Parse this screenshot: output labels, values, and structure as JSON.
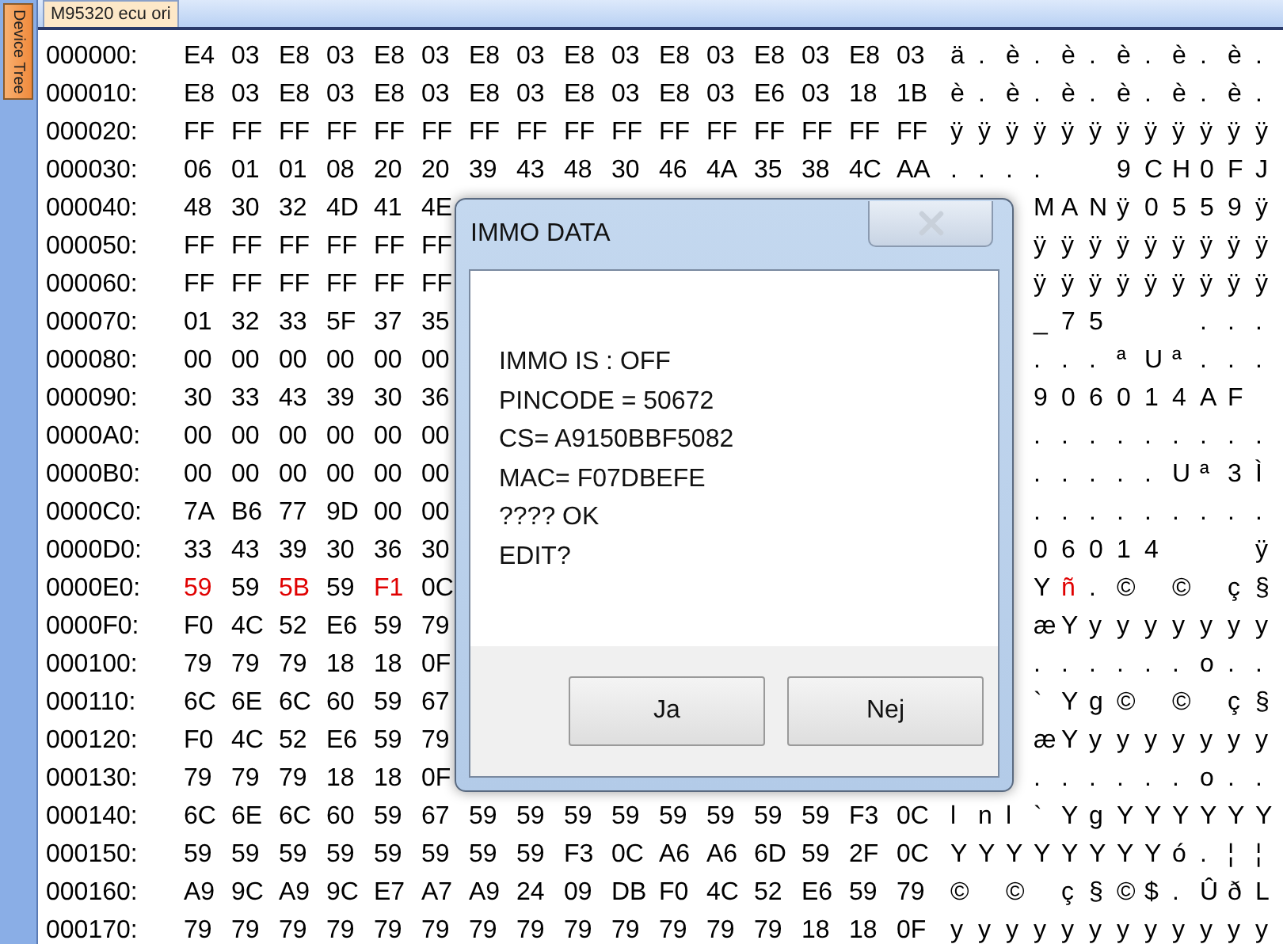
{
  "sidebar": {
    "tab": "Device Tree"
  },
  "tabs": [
    {
      "label": "M95320 ecu ori",
      "selected": true
    }
  ],
  "rows": [
    {
      "offset": "000000:",
      "hex": [
        "E4",
        "03",
        "E8",
        "03",
        "E8",
        "03",
        "E8",
        "03",
        "E8",
        "03",
        "E8",
        "03",
        "E8",
        "03",
        "E8",
        "03"
      ],
      "ascii": "ä . è . è . è . è . è ."
    },
    {
      "offset": "000010:",
      "hex": [
        "E8",
        "03",
        "E8",
        "03",
        "E8",
        "03",
        "E8",
        "03",
        "E8",
        "03",
        "E8",
        "03",
        "E6",
        "03",
        "18",
        "1B"
      ],
      "ascii": "è . è . è . è . è . è ."
    },
    {
      "offset": "000020:",
      "hex": [
        "FF",
        "FF",
        "FF",
        "FF",
        "FF",
        "FF",
        "FF",
        "FF",
        "FF",
        "FF",
        "FF",
        "FF",
        "FF",
        "FF",
        "FF",
        "FF"
      ],
      "ascii": "ÿ ÿ ÿ ÿ ÿ ÿ ÿ ÿ ÿ ÿ ÿ ÿ"
    },
    {
      "offset": "000030:",
      "hex": [
        "06",
        "01",
        "01",
        "08",
        "20",
        "20",
        "39",
        "43",
        "48",
        "30",
        "46",
        "4A",
        "35",
        "38",
        "4C",
        "AA"
      ],
      "ascii": ". . . .     9 C H 0 F J"
    },
    {
      "offset": "000040:",
      "hex": [
        "48",
        "30",
        "32",
        "4D",
        "41",
        "4E"
      ],
      "ascii_tail": "M A N ÿ 0 5 5 9 ÿ"
    },
    {
      "offset": "000050:",
      "hex": [
        "FF",
        "FF",
        "FF",
        "FF",
        "FF",
        "FF"
      ],
      "ascii_tail": "ÿ ÿ ÿ ÿ ÿ ÿ ÿ ÿ ÿ"
    },
    {
      "offset": "000060:",
      "hex": [
        "FF",
        "FF",
        "FF",
        "FF",
        "FF",
        "FF"
      ],
      "ascii_tail": "ÿ ÿ ÿ ÿ ÿ ÿ ÿ ÿ ÿ"
    },
    {
      "offset": "000070:",
      "hex": [
        "01",
        "32",
        "33",
        "5F",
        "37",
        "35"
      ],
      "ascii_tail": "_ 7 5       . . ."
    },
    {
      "offset": "000080:",
      "hex": [
        "00",
        "00",
        "00",
        "00",
        "00",
        "00"
      ],
      "ascii_tail": ". . . ª U ª . . ."
    },
    {
      "offset": "000090:",
      "hex": [
        "30",
        "33",
        "43",
        "39",
        "30",
        "36"
      ],
      "ascii_tail": "9 0 6 0 1 4 A F"
    },
    {
      "offset": "0000A0:",
      "hex": [
        "00",
        "00",
        "00",
        "00",
        "00",
        "00"
      ],
      "ascii_tail": ". . . . . . . . ."
    },
    {
      "offset": "0000B0:",
      "hex": [
        "00",
        "00",
        "00",
        "00",
        "00",
        "00"
      ],
      "ascii_tail": ". . . . . U ª 3 Ì"
    },
    {
      "offset": "0000C0:",
      "hex": [
        "7A",
        "B6",
        "77",
        "9D",
        "00",
        "00"
      ],
      "ascii_tail": ". . . . . . . . ."
    },
    {
      "offset": "0000D0:",
      "hex": [
        "33",
        "43",
        "39",
        "30",
        "36",
        "30"
      ],
      "ascii_tail": "0 6 0 1 4       ÿ"
    },
    {
      "offset": "0000E0:",
      "hex": [
        {
          "value": "59",
          "changed": true
        },
        {
          "value": "59",
          "changed": false
        },
        {
          "value": "5B",
          "changed": true
        },
        {
          "value": "59",
          "changed": false
        },
        {
          "value": "F1",
          "changed": true
        },
        {
          "value": "0C",
          "changed": false
        }
      ],
      "ascii_tail": [
        {
          "text": "Y",
          "changed": false
        },
        {
          "text": "ñ",
          "changed": true
        },
        {
          "text": ". ©   ©   ç §",
          "changed": false
        }
      ]
    },
    {
      "offset": "0000F0:",
      "hex": [
        "F0",
        "4C",
        "52",
        "E6",
        "59",
        "79"
      ],
      "ascii_tail": "æ Y y y y y y y y"
    },
    {
      "offset": "000100:",
      "hex": [
        "79",
        "79",
        "79",
        "18",
        "18",
        "0F"
      ],
      "ascii_tail": ". . . . . . o . ."
    },
    {
      "offset": "000110:",
      "hex": [
        "6C",
        "6E",
        "6C",
        "60",
        "59",
        "67"
      ],
      "ascii_tail": "` Y g ©   ©   ç §"
    },
    {
      "offset": "000120:",
      "hex": [
        "F0",
        "4C",
        "52",
        "E6",
        "59",
        "79"
      ],
      "ascii_tail": "æ Y y y y y y y y"
    },
    {
      "offset": "000130:",
      "hex": [
        "79",
        "79",
        "79",
        "18",
        "18",
        "0F"
      ],
      "ascii_tail": ". . . . . . o . ."
    },
    {
      "offset": "000140:",
      "hex": [
        "6C",
        "6E",
        "6C",
        "60",
        "59",
        "67",
        "59",
        "59",
        "59",
        "59",
        "59",
        "59",
        "59",
        "59",
        "F3",
        "0C"
      ],
      "ascii": "l n l ` Y g Y Y Y Y Y Y"
    },
    {
      "offset": "000150:",
      "hex": [
        "59",
        "59",
        "59",
        "59",
        "59",
        "59",
        "59",
        "59",
        "F3",
        "0C",
        "A6",
        "A6",
        "6D",
        "59",
        "2F",
        "0C"
      ],
      "ascii": "Y Y Y Y Y Y Y Y ó . ¦ ¦"
    },
    {
      "offset": "000160:",
      "hex": [
        "A9",
        "9C",
        "A9",
        "9C",
        "E7",
        "A7",
        "A9",
        "24",
        "09",
        "DB",
        "F0",
        "4C",
        "52",
        "E6",
        "59",
        "79"
      ],
      "ascii": "©   ©   ç § © $ . Û ð L"
    },
    {
      "offset": "000170:",
      "hex": [
        "79",
        "79",
        "79",
        "79",
        "79",
        "79",
        "79",
        "79",
        "79",
        "79",
        "79",
        "79",
        "79",
        "18",
        "18",
        "0F"
      ],
      "ascii": "y y y y y y y y y y y y"
    }
  ],
  "dialog": {
    "title": "IMMO DATA",
    "lines": [
      "IMMO IS : OFF",
      "PINCODE = 50672",
      "CS= A9150BBF5082",
      "MAC= F07DBEFE",
      "???? OK",
      "EDIT?"
    ],
    "buttons": [
      "Ja",
      "Nej"
    ]
  }
}
